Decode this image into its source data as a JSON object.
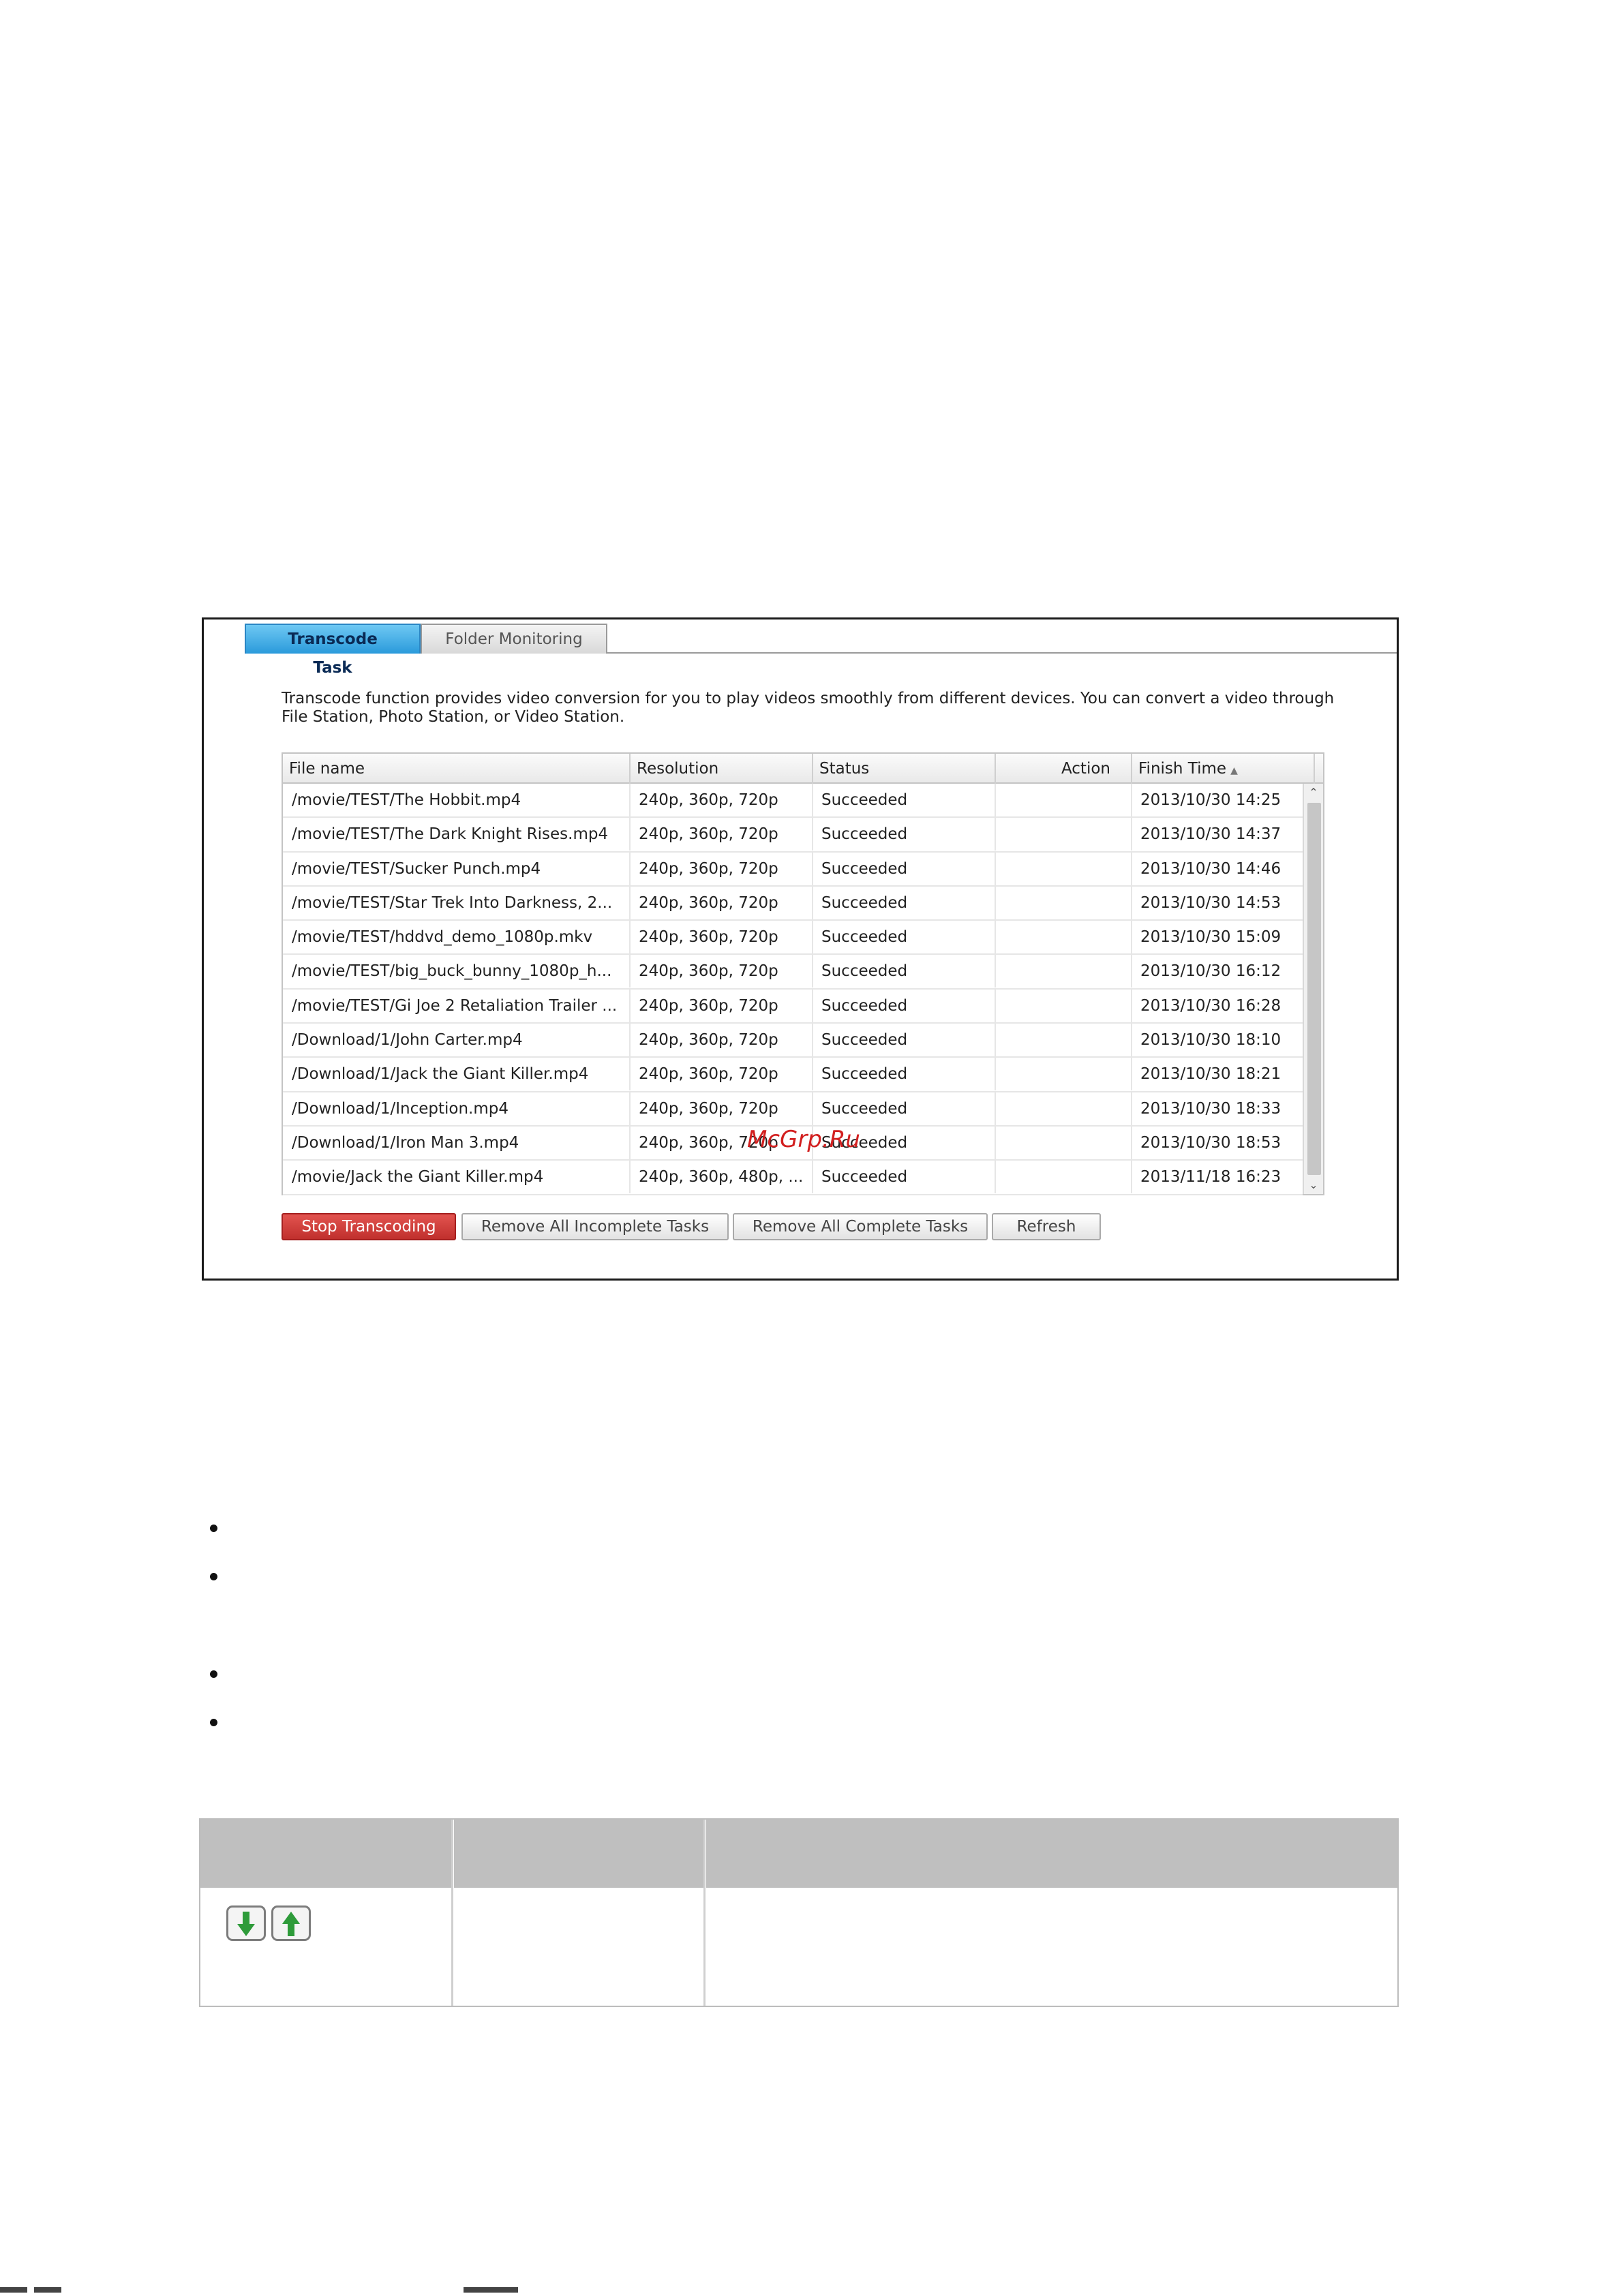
{
  "tabs": {
    "active": "Transcode Task",
    "inactive": "Folder Monitoring"
  },
  "description": "Transcode function provides video conversion for you to play videos smoothly from different devices. You can convert a video through File Station, Photo Station, or Video Station.",
  "grid": {
    "headers": {
      "file": "File name",
      "resolution": "Resolution",
      "status": "Status",
      "action": "Action",
      "finish": "Finish Time"
    },
    "rows": [
      {
        "file": "/movie/TEST/The Hobbit.mp4",
        "resolution": "240p, 360p, 720p",
        "status": "Succeeded",
        "action": "",
        "finish": "2013/10/30 14:25"
      },
      {
        "file": "/movie/TEST/The Dark Knight Rises.mp4",
        "resolution": "240p, 360p, 720p",
        "status": "Succeeded",
        "action": "",
        "finish": "2013/10/30 14:37"
      },
      {
        "file": "/movie/TEST/Sucker Punch.mp4",
        "resolution": "240p, 360p, 720p",
        "status": "Succeeded",
        "action": "",
        "finish": "2013/10/30 14:46"
      },
      {
        "file": "/movie/TEST/Star Trek Into Darkness, 2...",
        "resolution": "240p, 360p, 720p",
        "status": "Succeeded",
        "action": "",
        "finish": "2013/10/30 14:53"
      },
      {
        "file": "/movie/TEST/hddvd_demo_1080p.mkv",
        "resolution": "240p, 360p, 720p",
        "status": "Succeeded",
        "action": "",
        "finish": "2013/10/30 15:09"
      },
      {
        "file": "/movie/TEST/big_buck_bunny_1080p_h...",
        "resolution": "240p, 360p, 720p",
        "status": "Succeeded",
        "action": "",
        "finish": "2013/10/30 16:12"
      },
      {
        "file": "/movie/TEST/Gi Joe 2 Retaliation Trailer ...",
        "resolution": "240p, 360p, 720p",
        "status": "Succeeded",
        "action": "",
        "finish": "2013/10/30 16:28"
      },
      {
        "file": "/Download/1/John Carter.mp4",
        "resolution": "240p, 360p, 720p",
        "status": "Succeeded",
        "action": "",
        "finish": "2013/10/30 18:10"
      },
      {
        "file": "/Download/1/Jack the Giant Killer.mp4",
        "resolution": "240p, 360p, 720p",
        "status": "Succeeded",
        "action": "",
        "finish": "2013/10/30 18:21"
      },
      {
        "file": "/Download/1/Inception.mp4",
        "resolution": "240p, 360p, 720p",
        "status": "Succeeded",
        "action": "",
        "finish": "2013/10/30 18:33"
      },
      {
        "file": "/Download/1/Iron Man 3.mp4",
        "resolution": "240p, 360p, 720p",
        "status": "Succeeded",
        "action": "",
        "finish": "2013/10/30 18:53"
      },
      {
        "file": "/movie/Jack the Giant Killer.mp4",
        "resolution": "240p, 360p, 480p, ...",
        "status": "Succeeded",
        "action": "",
        "finish": "2013/11/18 16:23"
      }
    ]
  },
  "buttons": {
    "stop": "Stop Transcoding",
    "remove_incomplete": "Remove All Incomplete Tasks",
    "remove_complete": "Remove All Complete Tasks",
    "refresh": "Refresh"
  },
  "watermark": "McGrp.Ru",
  "icons": {
    "sort": "sort-ascending-icon",
    "scroll_up": "chevron-up-icon",
    "scroll_down": "chevron-down-icon",
    "move_down": "arrow-down-icon",
    "move_up": "arrow-up-icon"
  },
  "colors": {
    "tab_active": "#2a9adb",
    "stop_button": "#c0302d",
    "watermark": "#d21f1f",
    "arrow_green": "#2e9b3a",
    "table_header": "#bfbfbf"
  }
}
